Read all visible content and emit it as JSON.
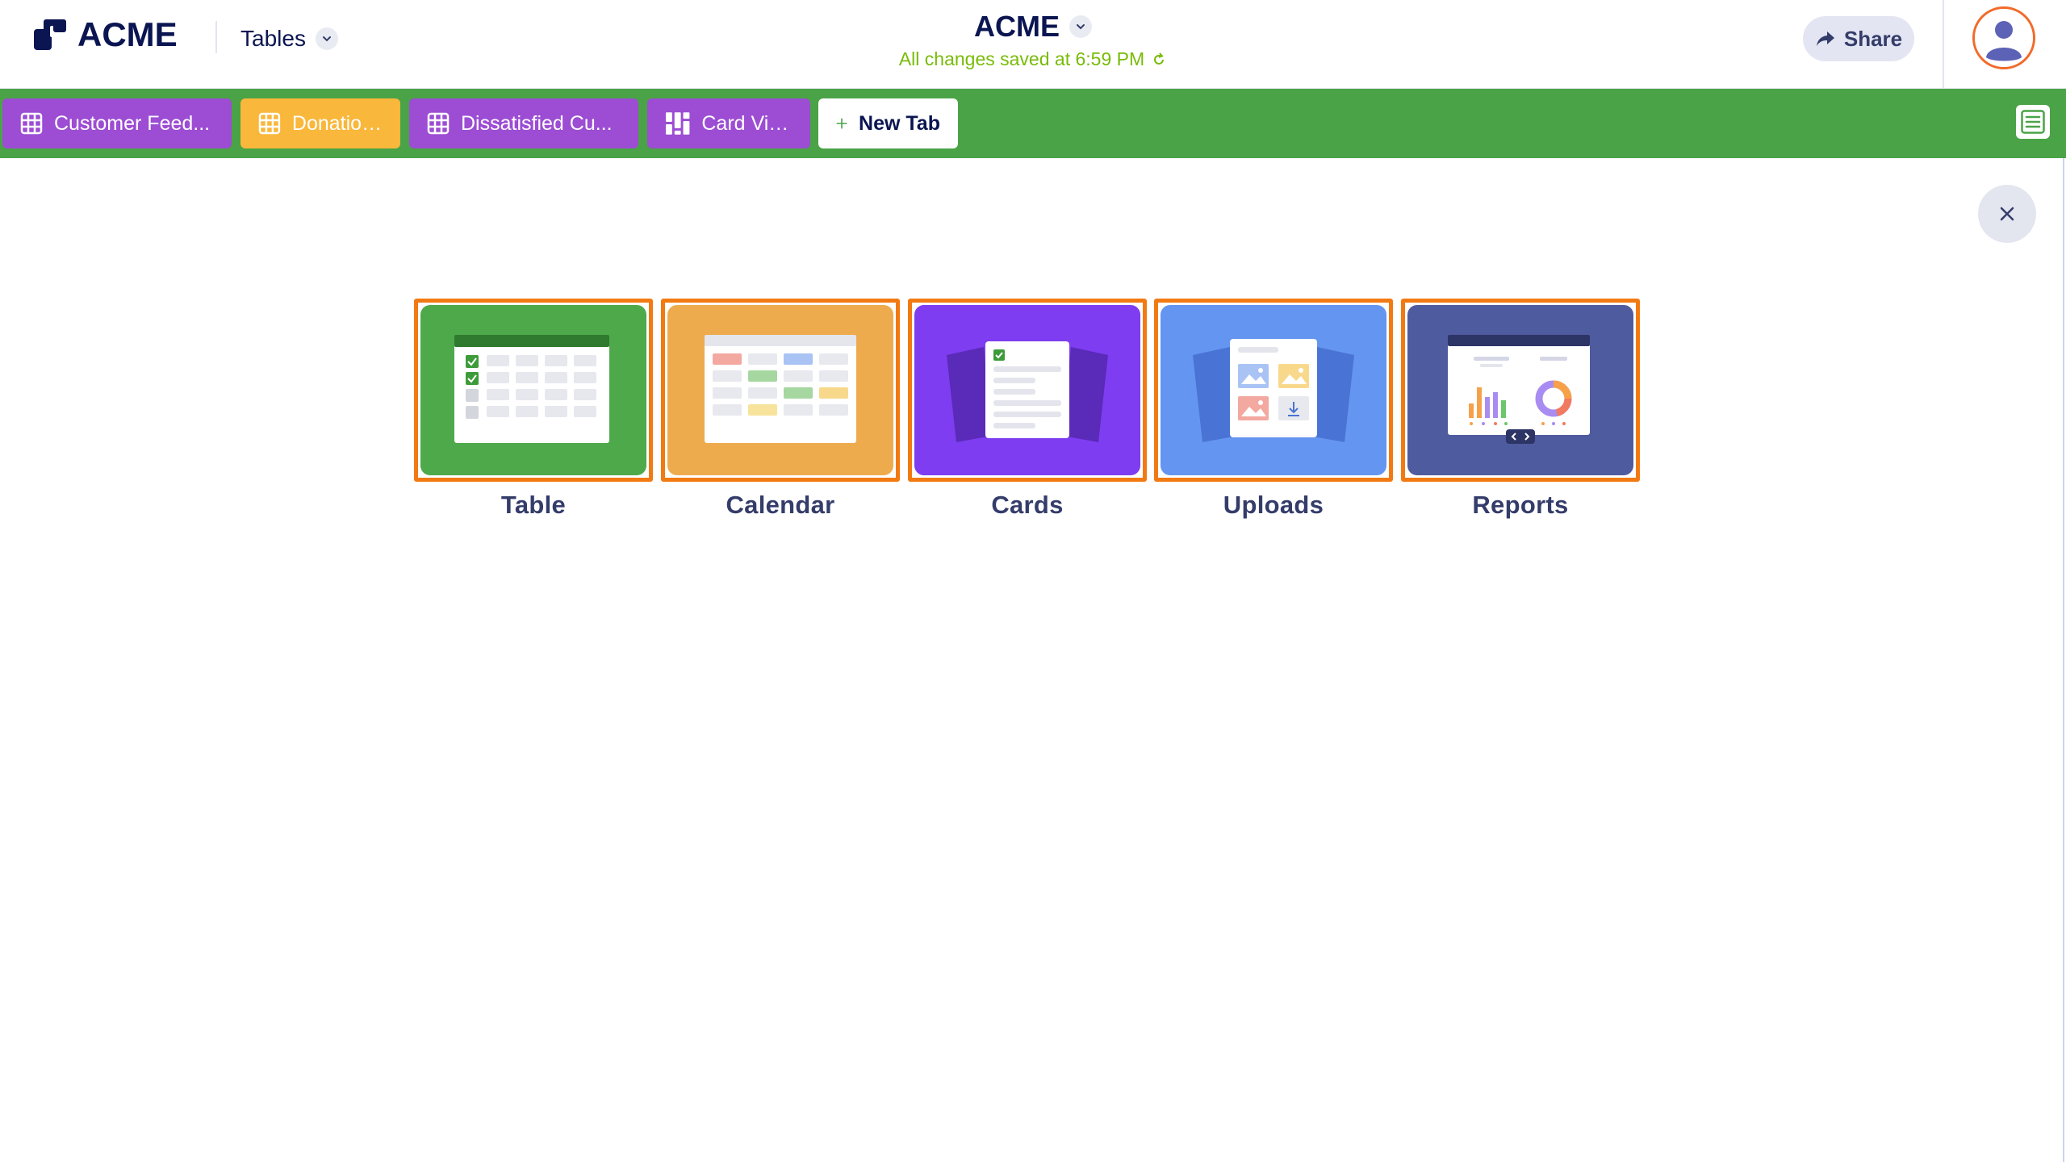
{
  "header": {
    "logo_text": "ACME",
    "product_label": "Tables",
    "title": "ACME",
    "save_status": "All changes saved at 6:59 PM",
    "share_label": "Share"
  },
  "tabs": [
    {
      "label": "Customer Feed...",
      "icon": "grid-icon",
      "color": "#9c4dd3"
    },
    {
      "label": "Donations",
      "icon": "grid-icon",
      "color": "#f9b73b"
    },
    {
      "label": "Dissatisfied Cu...",
      "icon": "grid-icon",
      "color": "#9c4dd3"
    },
    {
      "label": "Card View",
      "icon": "card-view-icon",
      "color": "#9c4dd3"
    }
  ],
  "new_tab_label": "New Tab",
  "views": [
    {
      "label": "Table",
      "bg": "#4ea94a"
    },
    {
      "label": "Calendar",
      "bg": "#eeab4e"
    },
    {
      "label": "Cards",
      "bg": "#7e3df0"
    },
    {
      "label": "Uploads",
      "bg": "#6495f0"
    },
    {
      "label": "Reports",
      "bg": "#4e5b9e"
    }
  ],
  "colors": {
    "tabbar": "#4aa346",
    "accent_border": "#f27a12",
    "save_status": "#78bb07",
    "navy": "#0a1551"
  }
}
